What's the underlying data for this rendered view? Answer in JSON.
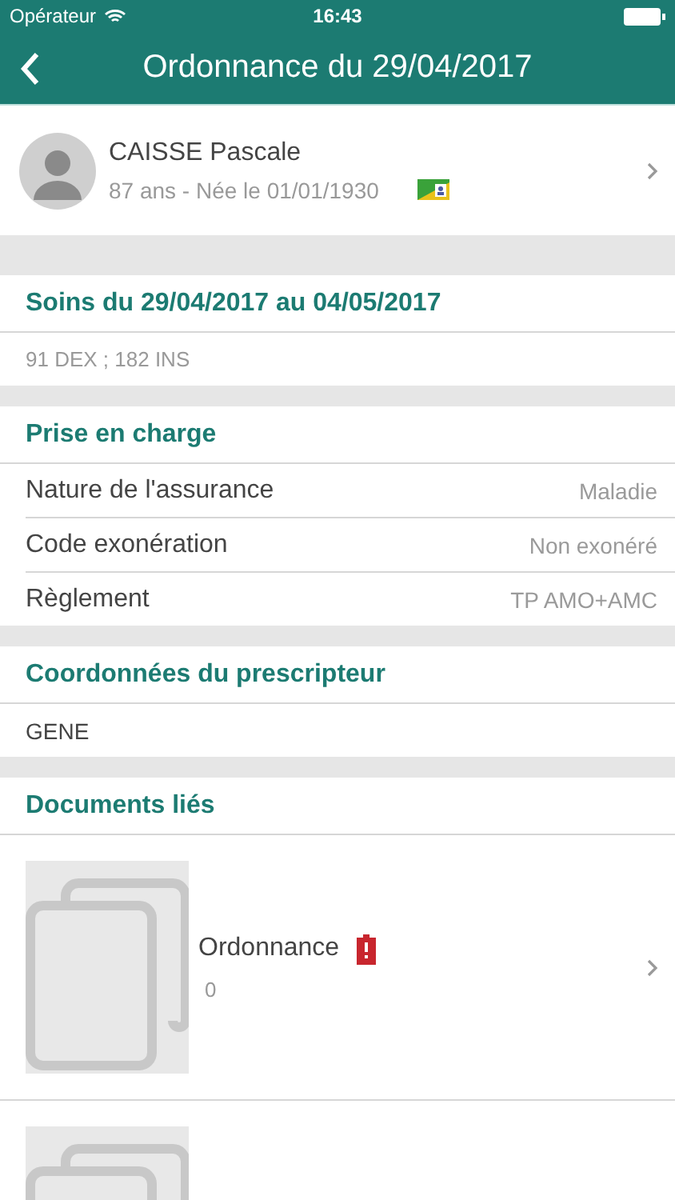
{
  "status_bar": {
    "carrier": "Opérateur",
    "time": "16:43"
  },
  "nav": {
    "title": "Ordonnance du 29/04/2017"
  },
  "patient": {
    "name": "CAISSE Pascale",
    "details": "87 ans - Née le 01/01/1930",
    "has_card": true
  },
  "sections": [
    {
      "kind": "text",
      "title": "Soins du 29/04/2017 au 04/05/2017",
      "text": "91 DEX ; 182 INS",
      "muted": true
    },
    {
      "kind": "fields",
      "title": "Prise en charge",
      "rows": [
        {
          "label": "Nature de l'assurance",
          "value": "Maladie"
        },
        {
          "label": "Code exonération",
          "value": "Non exonéré"
        },
        {
          "label": "Règlement",
          "value": "TP AMO+AMC"
        }
      ]
    },
    {
      "kind": "text",
      "title": "Coordonnées du prescripteur",
      "text": "GENE",
      "muted": false
    },
    {
      "kind": "documents",
      "title": "Documents liés",
      "documents": [
        {
          "kind": "full",
          "title": "Ordonnance",
          "count": "0",
          "alert": true
        },
        {
          "kind": "cut"
        }
      ]
    }
  ]
}
